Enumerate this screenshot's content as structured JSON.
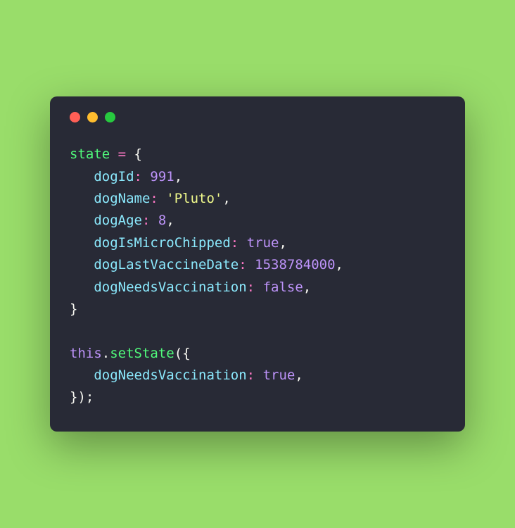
{
  "code": {
    "state_keyword": "state",
    "equals": " = ",
    "open_brace": "{",
    "close_brace": "}",
    "comma": ",",
    "colon": ": ",
    "indent": "   ",
    "props": {
      "dogId": {
        "key": "dogId",
        "val": "991",
        "type": "num"
      },
      "dogName": {
        "key": "dogName",
        "val": "'Pluto'",
        "type": "str"
      },
      "dogAge": {
        "key": "dogAge",
        "val": "8",
        "type": "num"
      },
      "dogIsMicroChipped": {
        "key": "dogIsMicroChipped",
        "val": "true",
        "type": "bool"
      },
      "dogLastVaccineDate": {
        "key": "dogLastVaccineDate",
        "val": "1538784000",
        "type": "num"
      },
      "dogNeedsVaccination": {
        "key": "dogNeedsVaccination",
        "val": "false",
        "type": "bool"
      }
    },
    "this_kw": "this",
    "dot": ".",
    "setState": "setState",
    "open_paren": "(",
    "close_paren": ")",
    "semicolon": ";",
    "update": {
      "key": "dogNeedsVaccination",
      "val": "true",
      "type": "bool"
    }
  }
}
